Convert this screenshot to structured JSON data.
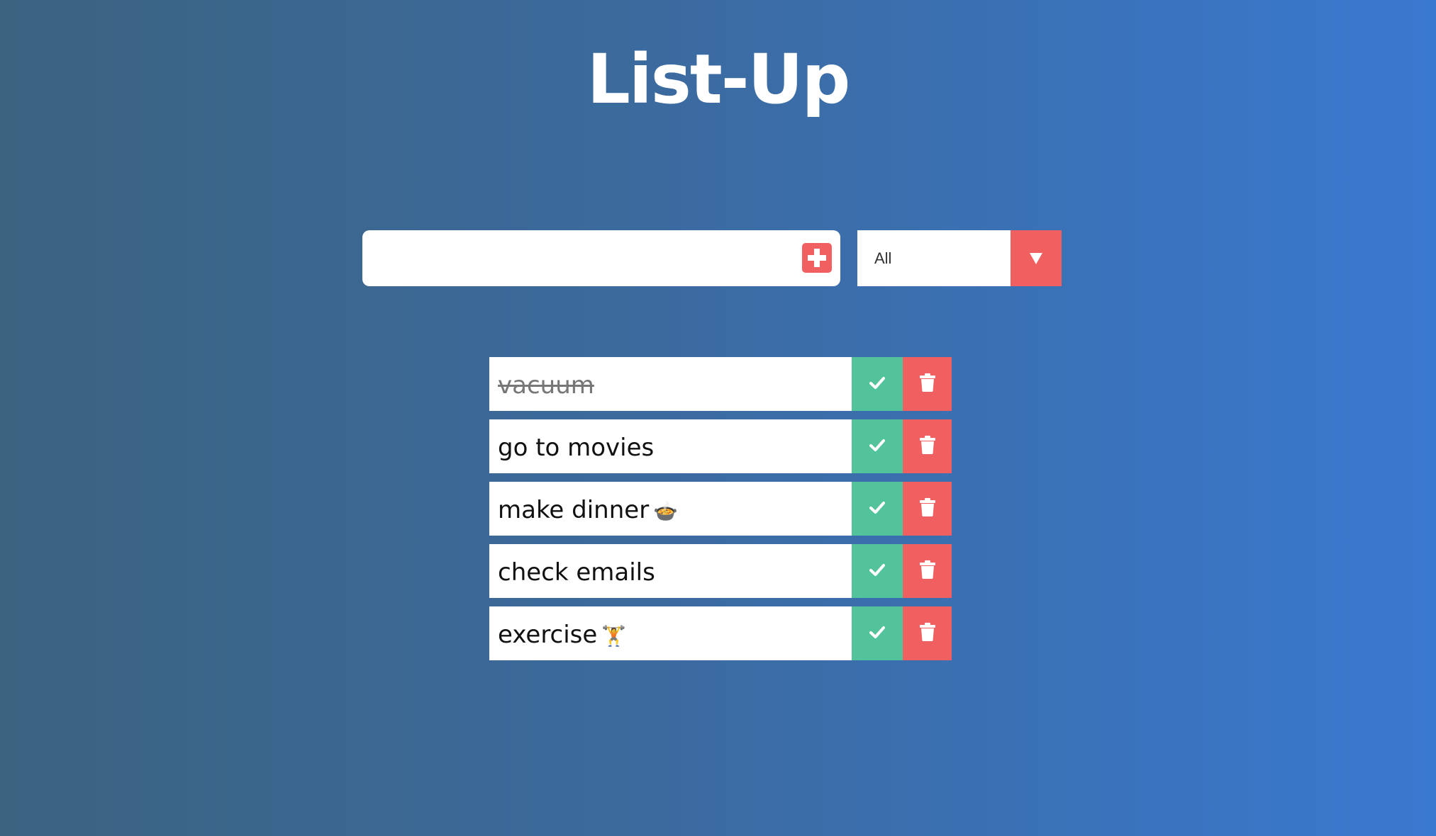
{
  "app": {
    "title": "List-Up"
  },
  "entry": {
    "value": "",
    "placeholder": "",
    "add_icon": "plus-square-icon"
  },
  "filter": {
    "selected": "All",
    "arrow_icon": "caret-down-icon"
  },
  "todos": [
    {
      "text": "vacuum",
      "emoji": "",
      "completed": true
    },
    {
      "text": "go to movies",
      "emoji": "",
      "completed": false
    },
    {
      "text": "make dinner",
      "emoji": "🍲",
      "completed": false
    },
    {
      "text": "check emails",
      "emoji": "",
      "completed": false
    },
    {
      "text": "exercise",
      "emoji": "🏋️",
      "completed": false
    }
  ],
  "item_icons": {
    "complete": "check-icon",
    "delete": "trash-icon"
  },
  "colors": {
    "accent_red": "#f06060",
    "accent_green": "#52c39b",
    "gradient_start": "#3b6380",
    "gradient_end": "#3a79d0"
  }
}
